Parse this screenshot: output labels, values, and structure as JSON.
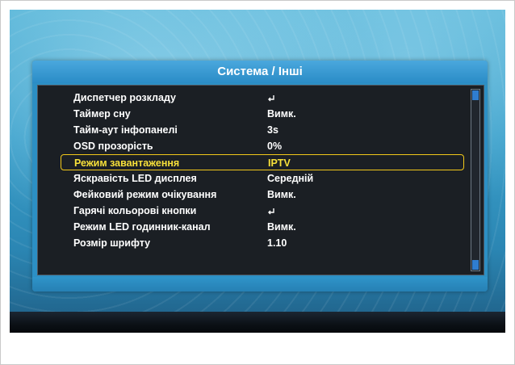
{
  "menu": {
    "title": "Система / Інші",
    "items": [
      {
        "label": "Диспетчер розкладу",
        "value": "",
        "icon": "enter-icon"
      },
      {
        "label": "Таймер сну",
        "value": "Вимк."
      },
      {
        "label": "Тайм-аут інфопанелі",
        "value": "3s"
      },
      {
        "label": "OSD прозорість",
        "value": "0%"
      },
      {
        "label": "Режим завантаження",
        "value": "IPTV",
        "selected": true
      },
      {
        "label": "Яскравість LED дисплея",
        "value": "Середній"
      },
      {
        "label": "Фейковий режим очікування",
        "value": "Вимк."
      },
      {
        "label": "Гарячі кольорові кнопки",
        "value": "",
        "icon": "enter-icon"
      },
      {
        "label": "Режим LED годинник-канал",
        "value": "Вимк."
      },
      {
        "label": "Розмір шрифту",
        "value": "1.10"
      }
    ]
  },
  "colors": {
    "panel_blue": "#2c8fc4",
    "highlight": "#f2c81a",
    "text": "#ffffff",
    "scrollbar_thumb": "#2f7dd0"
  }
}
